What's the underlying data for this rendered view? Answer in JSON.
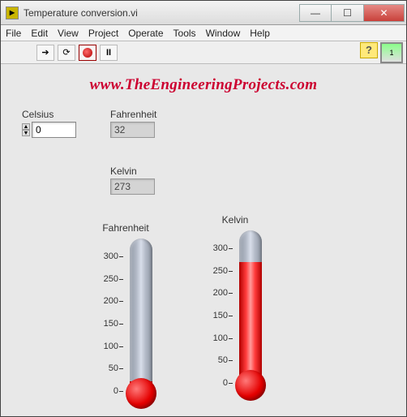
{
  "window": {
    "title": "Temperature conversion.vi"
  },
  "menu": {
    "file": "File",
    "edit": "Edit",
    "view": "View",
    "project": "Project",
    "operate": "Operate",
    "tools": "Tools",
    "window": "Window",
    "help": "Help"
  },
  "watermark": "www.TheEngineeringProjects.com",
  "fields": {
    "celsius": {
      "label": "Celsius",
      "value": "0"
    },
    "fahrenheit": {
      "label": "Fahrenheit",
      "value": "32"
    },
    "kelvin": {
      "label": "Kelvin",
      "value": "273"
    }
  },
  "thermometers": {
    "fahrenheit": {
      "label": "Fahrenheit",
      "ticks": [
        "300",
        "250",
        "200",
        "150",
        "100",
        "50",
        "0"
      ]
    },
    "kelvin": {
      "label": "Kelvin",
      "ticks": [
        "300",
        "250",
        "200",
        "150",
        "100",
        "50",
        "0"
      ]
    }
  },
  "chart_data": [
    {
      "type": "bar",
      "title": "Fahrenheit",
      "categories": [
        "Fahrenheit"
      ],
      "values": [
        32
      ],
      "ylim": [
        0,
        300
      ],
      "ylabel": "",
      "xlabel": ""
    },
    {
      "type": "bar",
      "title": "Kelvin",
      "categories": [
        "Kelvin"
      ],
      "values": [
        273
      ],
      "ylim": [
        0,
        300
      ],
      "ylabel": "",
      "xlabel": ""
    }
  ]
}
